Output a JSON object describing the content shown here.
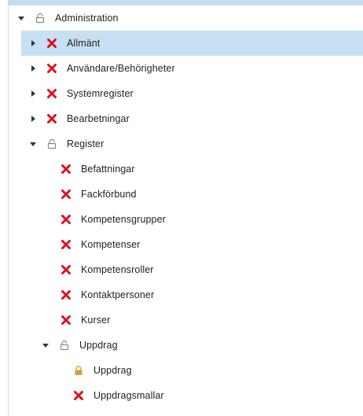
{
  "tree": {
    "root": {
      "label": "Administration",
      "icon": "lock-open-icon",
      "state": "expanded"
    },
    "items": [
      {
        "label": "Allmänt",
        "icon": "red-x-icon",
        "state": "collapsed",
        "selected": true
      },
      {
        "label": "Användare/Behörigheter",
        "icon": "red-x-icon",
        "state": "collapsed"
      },
      {
        "label": "Systemregister",
        "icon": "red-x-icon",
        "state": "collapsed"
      },
      {
        "label": "Bearbetningar",
        "icon": "red-x-icon",
        "state": "collapsed"
      },
      {
        "label": "Register",
        "icon": "lock-open-icon",
        "state": "expanded"
      }
    ],
    "register_children": [
      {
        "label": "Befattningar",
        "icon": "red-x-icon"
      },
      {
        "label": "Fackförbund",
        "icon": "red-x-icon"
      },
      {
        "label": "Kompetensgrupper",
        "icon": "red-x-icon"
      },
      {
        "label": "Kompetenser",
        "icon": "red-x-icon"
      },
      {
        "label": "Kompetensroller",
        "icon": "red-x-icon"
      },
      {
        "label": "Kontaktpersoner",
        "icon": "red-x-icon"
      },
      {
        "label": "Kurser",
        "icon": "red-x-icon"
      },
      {
        "label": "Uppdrag",
        "icon": "lock-open-icon",
        "state": "expanded"
      }
    ],
    "uppdrag_children": [
      {
        "label": "Uppdrag",
        "icon": "lock-closed-icon"
      },
      {
        "label": "Uppdragsmallar",
        "icon": "red-x-icon"
      }
    ]
  },
  "colors": {
    "selected_bg": "#c7e0f4",
    "x_red": "#e0101a",
    "lock_gold": "#d7a23a",
    "lock_outline": "#8a8a8a",
    "toggle_dark": "#333333"
  }
}
